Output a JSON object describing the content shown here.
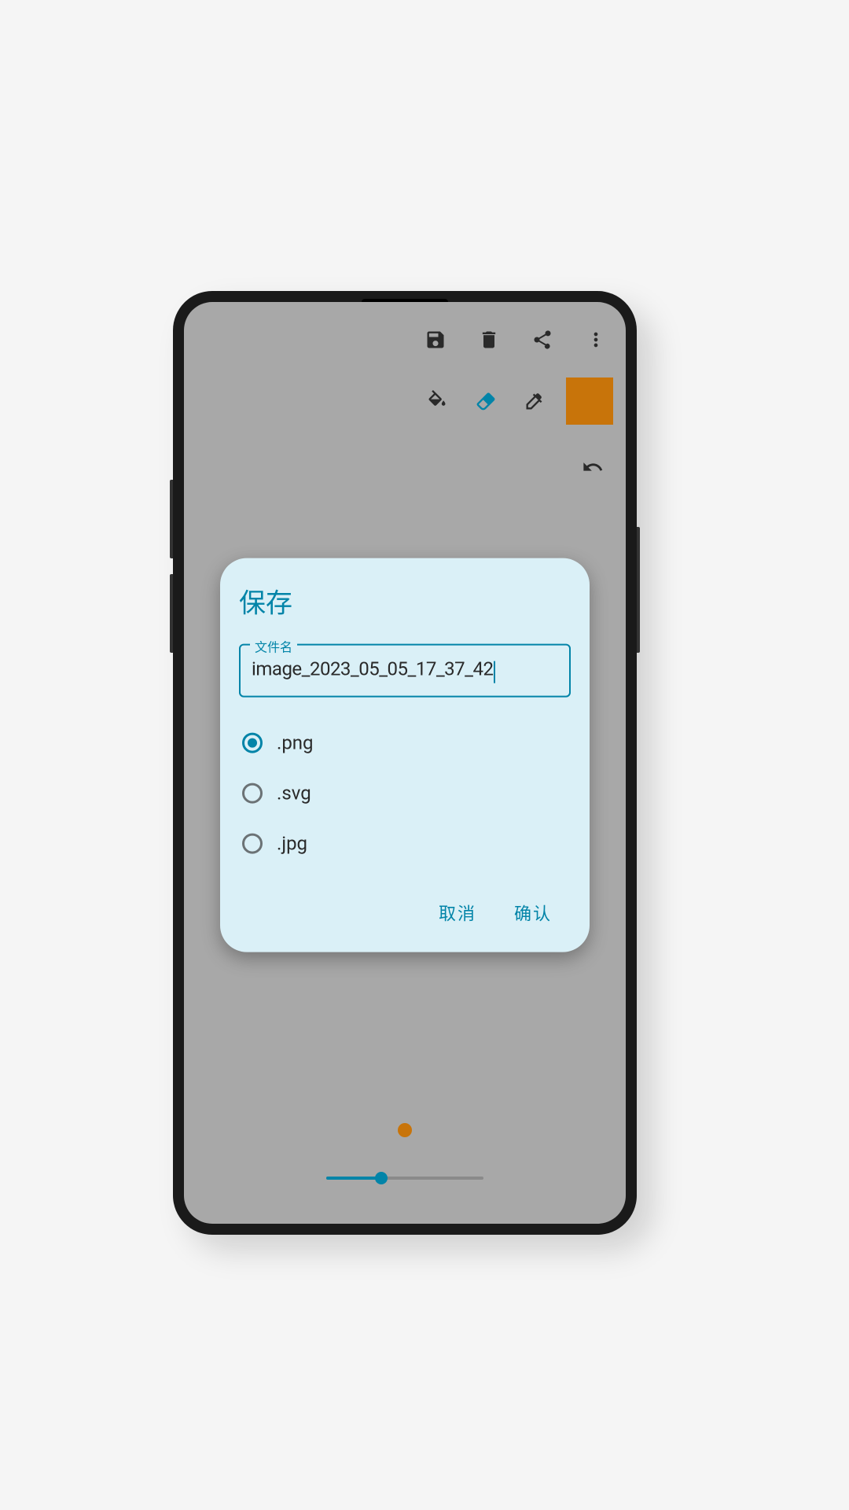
{
  "toolbar": {
    "save_icon": "save-icon",
    "delete_icon": "trash-icon",
    "share_icon": "share-icon",
    "more_icon": "more-vert-icon",
    "bucket_icon": "paint-bucket-icon",
    "eraser_icon": "eraser-icon",
    "eyedropper_icon": "eyedropper-icon",
    "undo_icon": "undo-icon",
    "swatch_color": "#c8740a"
  },
  "brush": {
    "preview_color": "#c8740a",
    "slider_percent": 35
  },
  "dialog": {
    "title": "保存",
    "filename_legend": "文件名",
    "filename_value": "image_2023_05_05_17_37_42",
    "formats": [
      {
        "label": ".png",
        "selected": true
      },
      {
        "label": ".svg",
        "selected": false
      },
      {
        "label": ".jpg",
        "selected": false
      }
    ],
    "cancel_label": "取消",
    "confirm_label": "确认"
  }
}
